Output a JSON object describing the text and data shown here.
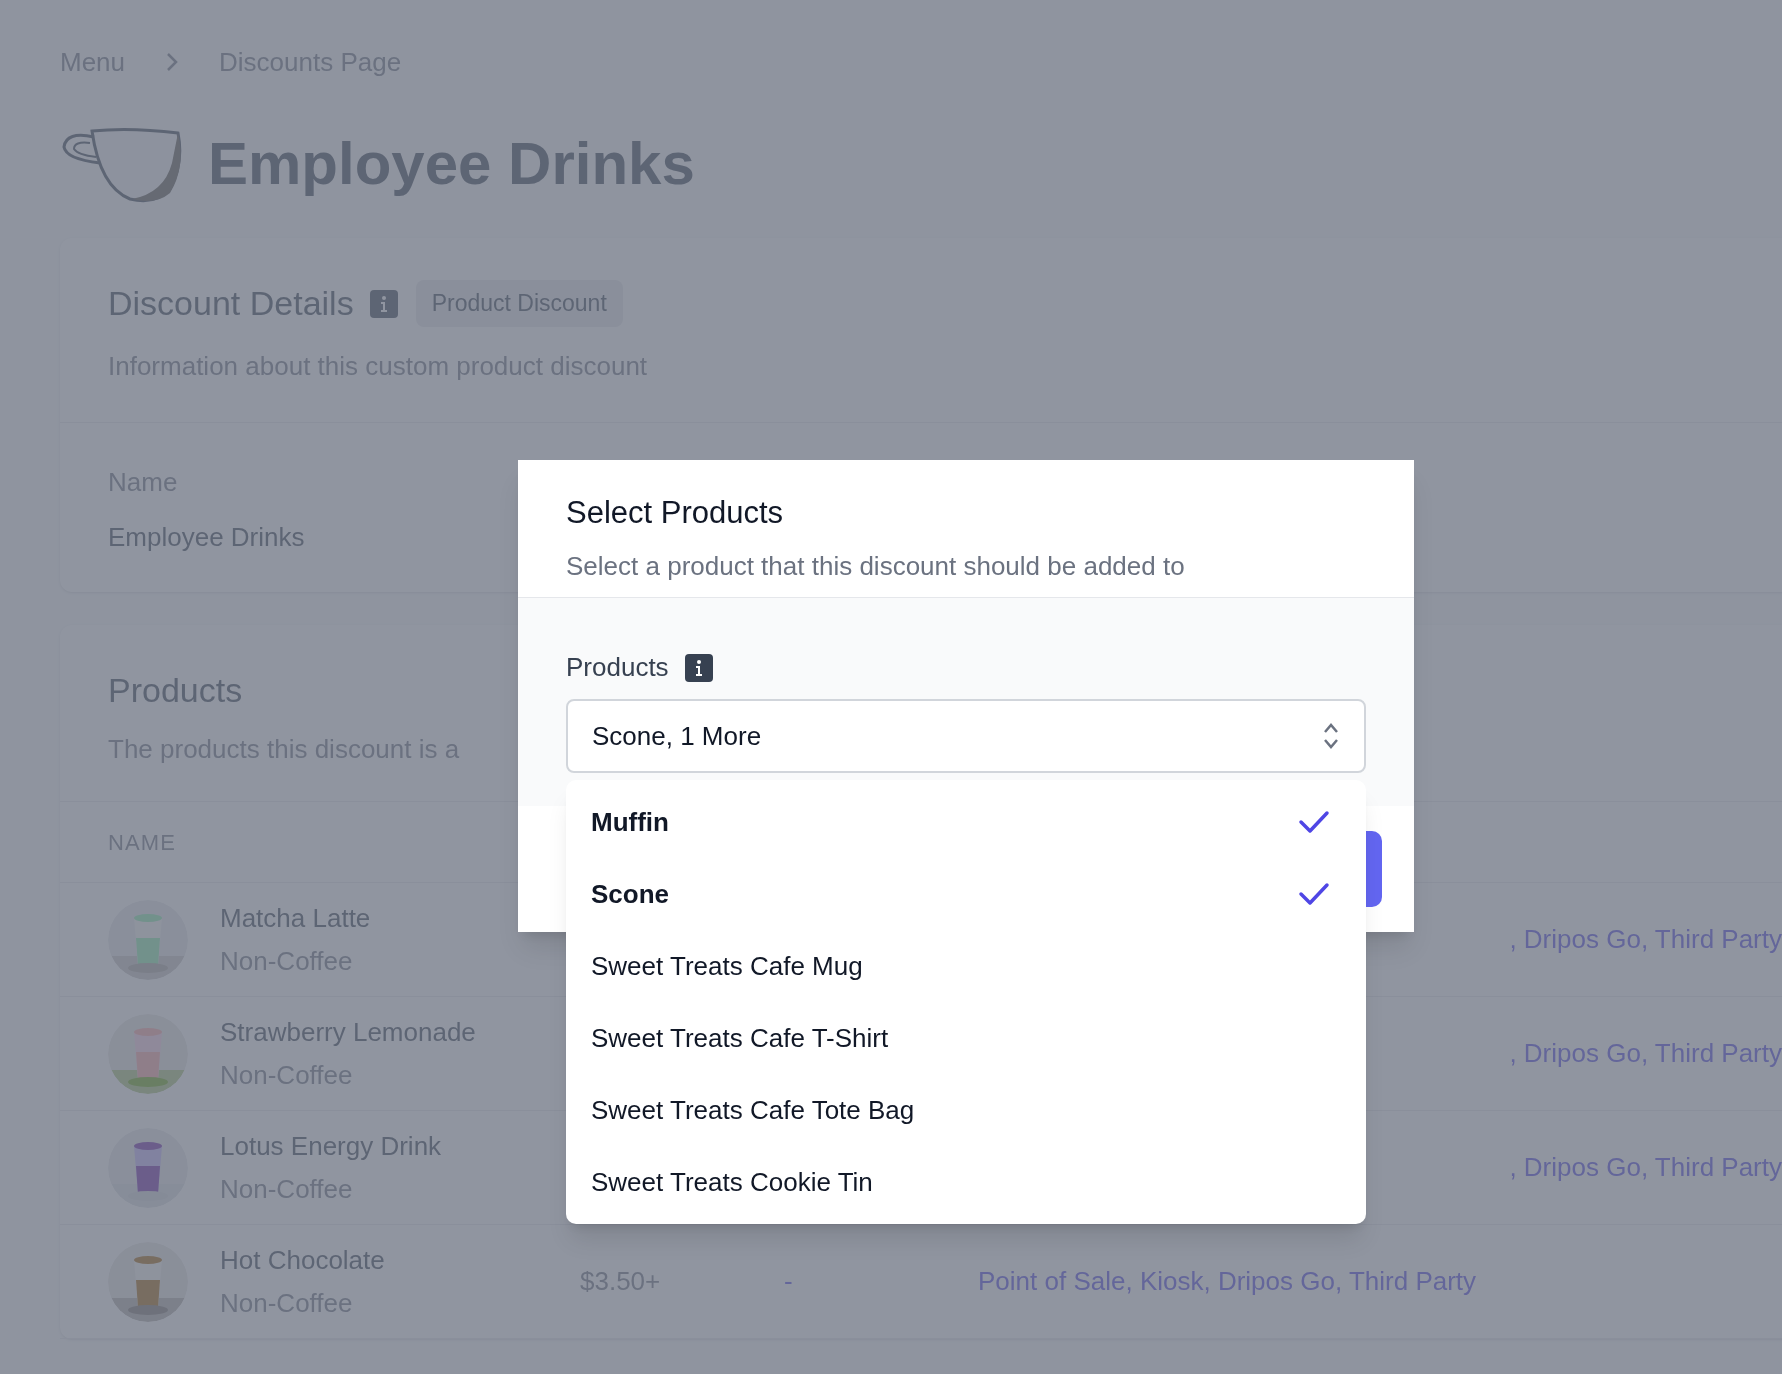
{
  "breadcrumb": [
    {
      "label": "Menu"
    },
    {
      "label": "Discounts Page"
    }
  ],
  "page_title": "Employee Drinks",
  "details_card": {
    "title": "Discount Details",
    "badge": "Product Discount",
    "description": "Information about this custom product discount",
    "fields": [
      {
        "label": "Name",
        "value": "Employee Drinks"
      }
    ]
  },
  "products_card": {
    "title": "Products",
    "description": "The products this discount is a",
    "columns": [
      "NAME"
    ],
    "rows": [
      {
        "name": "Matcha Latte",
        "category": "Non-Coffee",
        "platforms": ", Dripos Go, Third Party"
      },
      {
        "name": "Strawberry Lemonade",
        "category": "Non-Coffee",
        "platforms": ", Dripos Go, Third Party"
      },
      {
        "name": "Lotus Energy Drink",
        "category": "Non-Coffee",
        "platforms": ", Dripos Go, Third Party"
      },
      {
        "name": "Hot Chocolate",
        "category": "Non-Coffee",
        "price": "$3.50+",
        "discount": "-",
        "platforms": "Point of Sale, Kiosk, Dripos Go, Third Party"
      }
    ]
  },
  "modal": {
    "title": "Select Products",
    "subtitle": "Select a product that this discount should be added to",
    "field_label": "Products",
    "select_value": "Scone, 1 More",
    "options": [
      {
        "label": "Muffin",
        "selected": true
      },
      {
        "label": "Scone",
        "selected": true
      },
      {
        "label": "Sweet Treats Cafe Mug",
        "selected": false
      },
      {
        "label": "Sweet Treats Cafe T-Shirt",
        "selected": false
      },
      {
        "label": "Sweet Treats Cafe Tote Bag",
        "selected": false
      },
      {
        "label": "Sweet Treats Cookie Tin",
        "selected": false
      }
    ]
  }
}
